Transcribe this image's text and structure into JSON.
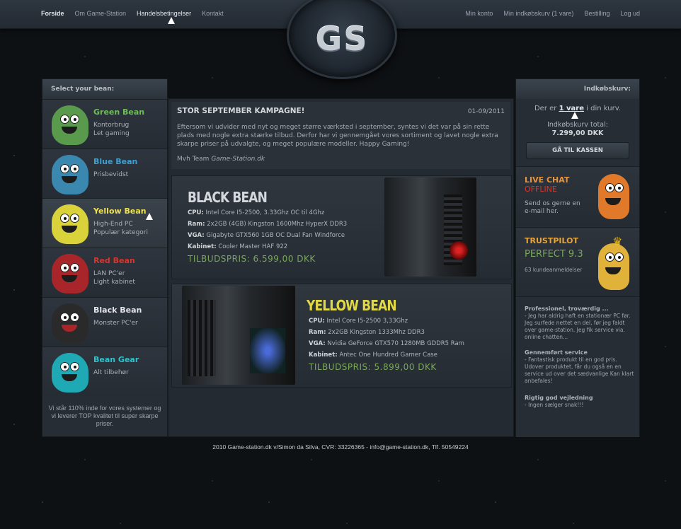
{
  "nav_left": [
    "Forside",
    "Om Game-Station",
    "Handelsbetingelser",
    "Kontakt"
  ],
  "nav_right": [
    "Min konto",
    "Min indkøbskurv (1 vare)",
    "Bestilling",
    "Log ud"
  ],
  "logo": "GS",
  "left": {
    "header": "Select your bean:",
    "beans": [
      {
        "name": "Green Bean",
        "desc1": "Kontorbrug",
        "desc2": "Let gaming",
        "color": "#5a9a4d",
        "name_color": "#6cbf55"
      },
      {
        "name": "Blue Bean",
        "desc1": "Prisbevidst",
        "desc2": "",
        "color": "#3a88b0",
        "name_color": "#3e9fd1"
      },
      {
        "name": "Yellow Bean",
        "desc1": "High-End PC",
        "desc2": "Populær kategori",
        "color": "#d9d23a",
        "name_color": "#f0e24a"
      },
      {
        "name": "Red Bean",
        "desc1": "LAN PC'er",
        "desc2": "Light kabinet",
        "color": "#a8262a",
        "name_color": "#d8352b"
      },
      {
        "name": "Black Bean",
        "desc1": "Monster PC'er",
        "desc2": "",
        "color": "#2a2a2a",
        "name_color": "#e2e6ea"
      },
      {
        "name": "Bean Gear",
        "desc1": "Alt tilbehør",
        "desc2": "",
        "color": "#1fa9b4",
        "name_color": "#2cc3cc"
      }
    ],
    "note": "Vi står 110% inde for vores systemer og vi leverer TOP kvalitet til super skarpe priser."
  },
  "news": {
    "title": "STOR SEPTEMBER KAMPAGNE!",
    "date": "01-09/2011",
    "body": "Eftersom vi udvider med nyt og meget større værksted i september, syntes vi det var på sin rette plads med nogle extra stærke tilbud. Derfor har vi gennemgået vores sortiment og lavet nogle extra skarpe priser på udvalgte, og meget populære modeller. Happy Gaming!",
    "sign_prefix": "Mvh Team ",
    "sign_name": "Game-Station.dk"
  },
  "offers": [
    {
      "title": "BLACK BEAN",
      "title_color": "#d4d8dc",
      "cpu_label": "CPU:",
      "cpu": "Intel Core I5-2500, 3.33Ghz OC til 4Ghz",
      "ram_label": "Ram:",
      "ram": "2x2GB (4GB) Kingston 1600Mhz HyperX DDR3",
      "vga_label": "VGA:",
      "vga": "Gigabyte GTX560 1GB OC Dual Fan Windforce",
      "case_label": "Kabinet:",
      "case": "Cooler Master HAF 922",
      "price": "TILBUDSPRIS: 6.599,00 DKK"
    },
    {
      "title": "YELLOW BEAN",
      "title_color": "#e0d844",
      "cpu_label": "CPU:",
      "cpu": "Intel Core I5-2500 3,33Ghz",
      "ram_label": "Ram:",
      "ram": "2x2GB Kingston 1333Mhz DDR3",
      "vga_label": "VGA:",
      "vga": "Nvidia GeForce GTX570 1280MB GDDR5 Ram",
      "case_label": "Kabinet:",
      "case": "Antec One Hundred Gamer Case",
      "price": "TILBUDSPRIS: 5.899,00 DKK"
    }
  ],
  "cart": {
    "header": "Indkøbskurv:",
    "text_prefix": "Der er ",
    "items": "1 vare",
    "text_suffix": " i din kurv.",
    "total_label": "Indkøbskurv total:",
    "total": "7.299,00 DKK",
    "checkout": "GÅ TIL KASSEN"
  },
  "chat": {
    "title": "LIVE CHAT",
    "status": "OFFLINE",
    "desc1": "Send os gerne en",
    "desc2": "e-mail her."
  },
  "trust": {
    "title": "TRUSTPILOT",
    "score": "PERFECT 9.3",
    "count": "63 kundeanmeldelser"
  },
  "reviews": [
    {
      "title": "Professionel, troværdig ...",
      "text": "- Jeg har aldrig haft en stationær PC før. Jeg surfede nettet en del, før jeg faldt over game-station. Jeg fik service via. online chatten..."
    },
    {
      "title": "Gennemført service",
      "text": "- Fantastisk produkt til en god pris. Udover produktet, får du også en en service ud over det sædvanlige Kan klart anbefales!"
    },
    {
      "title": "Rigtig god vejledning",
      "text": "- Ingen sælger snak!!!"
    }
  ],
  "footer": "2010 Game-station.dk v/Simon da Silva, CVR: 33226365 - info@game-station.dk, Tlf. 50549224"
}
